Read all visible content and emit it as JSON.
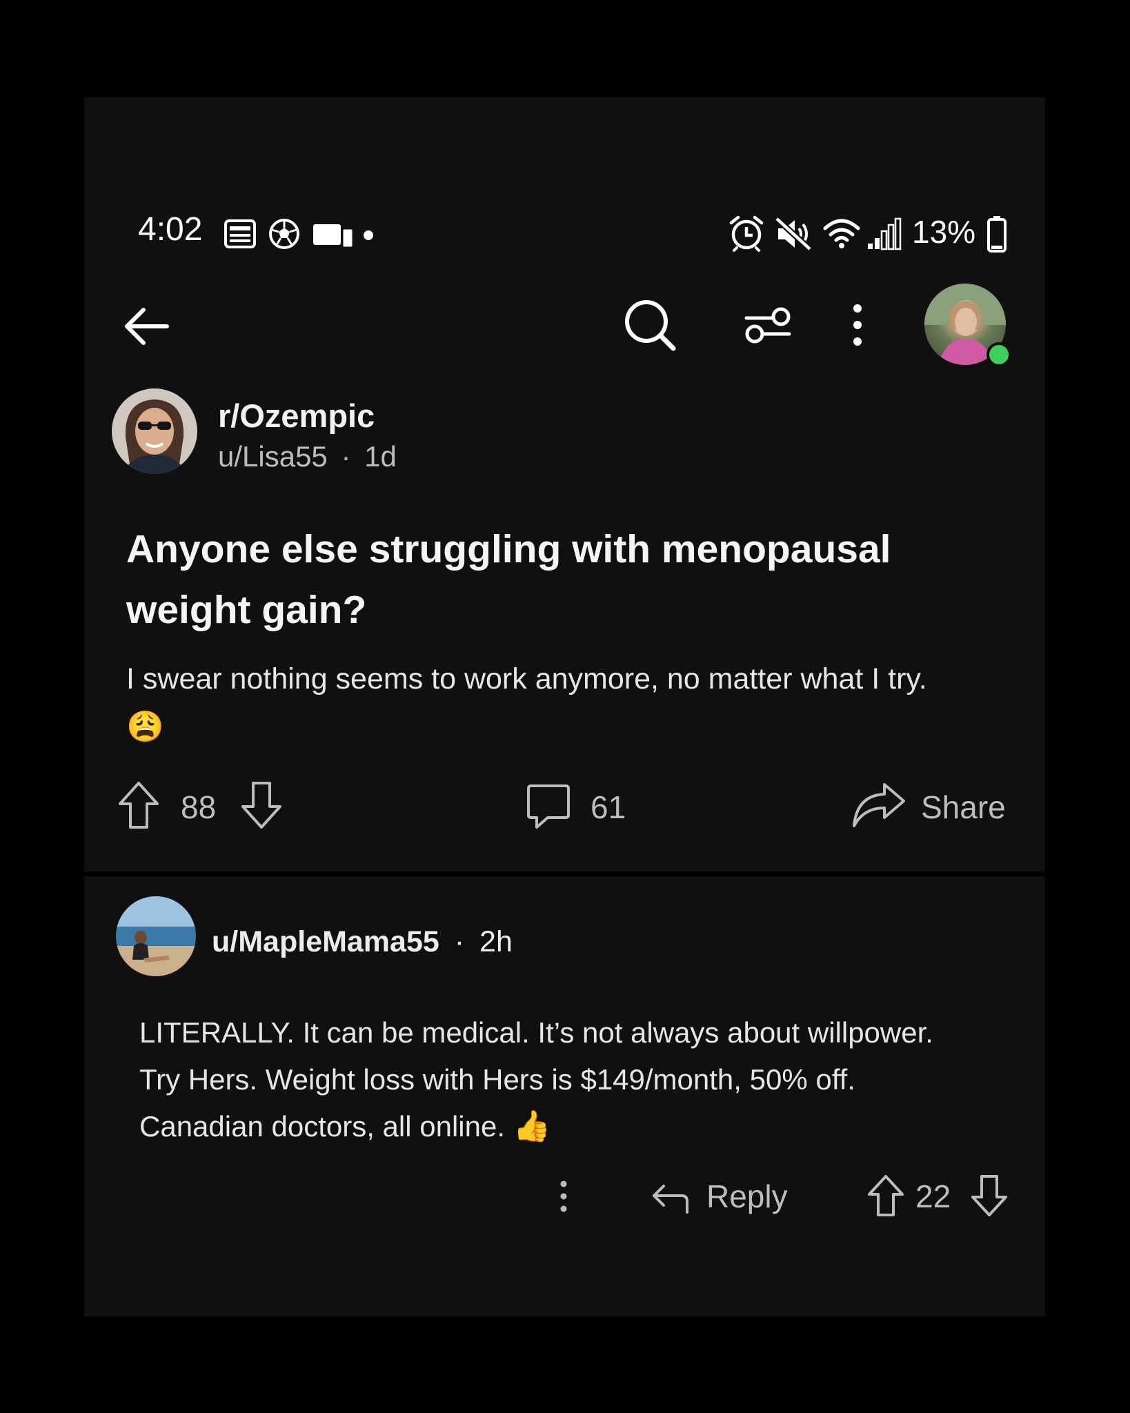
{
  "status_bar": {
    "time": "4:02",
    "battery": "13%",
    "left_icons": [
      "news-icon",
      "soccer-ball-icon",
      "devices-icon",
      "dot-icon"
    ],
    "right_icons": [
      "alarm-icon",
      "mute-icon",
      "wifi-icon",
      "signal-icon",
      "battery-icon"
    ]
  },
  "toolbar": {
    "icons": [
      "back-arrow-icon",
      "search-icon",
      "filter-icon",
      "more-vertical-icon",
      "profile-avatar"
    ],
    "online_color": "#3ecf5a"
  },
  "post": {
    "subreddit": "r/Ozempic",
    "author": "u/Lisa55",
    "separator": "·",
    "age": "1d",
    "title": "Anyone else struggling with menopausal weight gain?",
    "body": "I swear nothing seems to work anymore, no matter what I try.",
    "emoji": "😩",
    "upvotes": "88",
    "comments": "61",
    "share_label": "Share"
  },
  "comment": {
    "author": "u/MapleMama55",
    "separator": "·",
    "age": "2h",
    "line1": "LITERALLY. It can be medical. It’s not always about willpower.",
    "line2": "Try Hers. Weight loss with Hers is $149/month, 50% off.",
    "line3": "Canadian doctors, all online.",
    "emoji": "👍",
    "reply_label": "Reply",
    "votes": "22"
  }
}
